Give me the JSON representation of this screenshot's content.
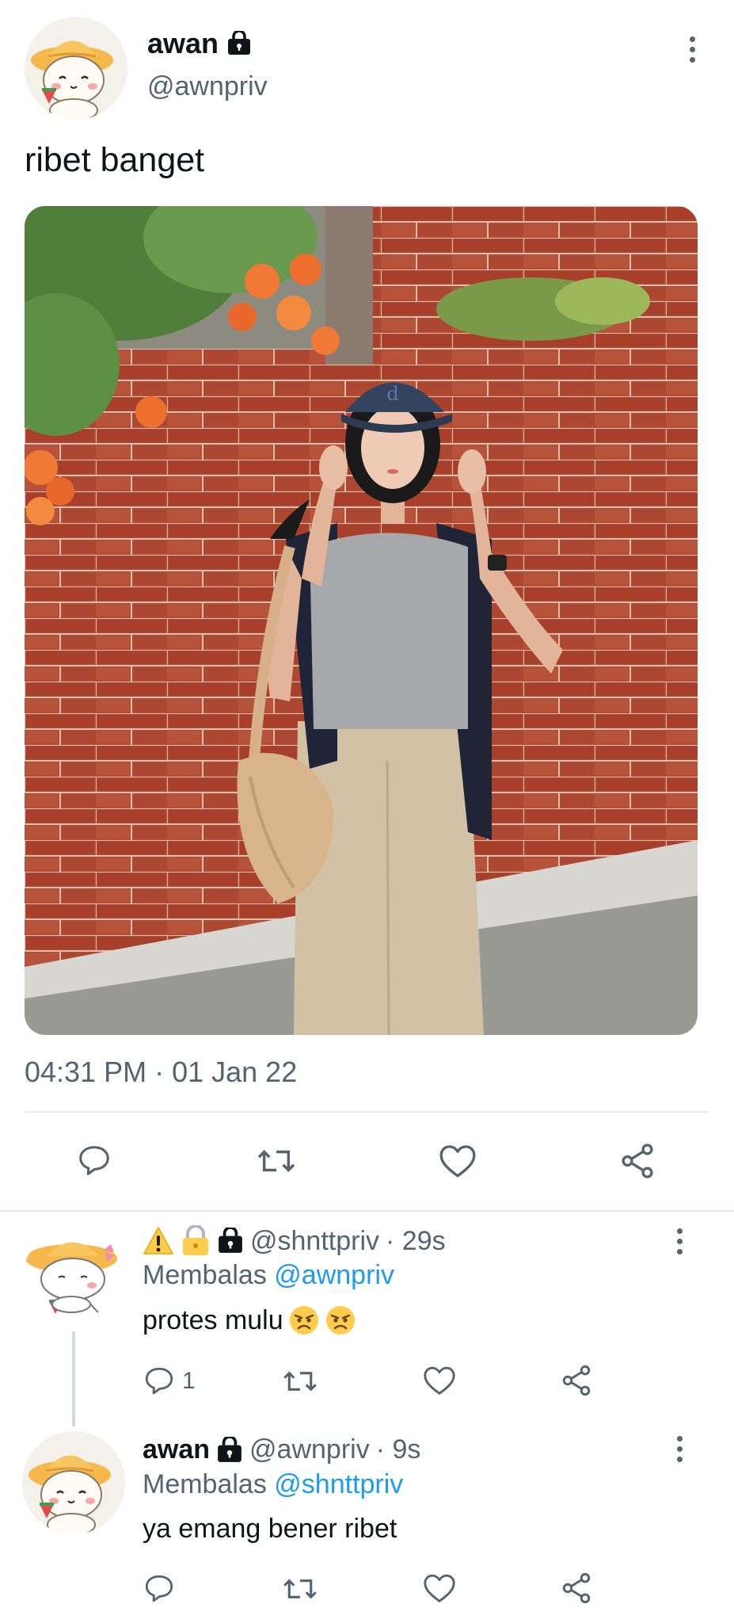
{
  "tweet": {
    "author_name": "awan",
    "author_handle": "@awnpriv",
    "text": "ribet banget",
    "timestamp": "04:31 PM · 01 Jan 22",
    "photo_alt": "woman in navy cap with grey tee and beige pants standing in front of a red brick wall with orange flowers",
    "icons": [
      "lock-icon",
      "more-icon",
      "reply-icon",
      "retweet-icon",
      "like-icon",
      "share-icon"
    ]
  },
  "replies": [
    {
      "author_name": "",
      "author_prefix_emojis": [
        "warning-emoji",
        "padlock-emoji"
      ],
      "author_handle": "@shnttpriv",
      "time": "· 29s",
      "replying_prefix": "Membalas",
      "replying_to": "@awnpriv",
      "text": "protes mulu",
      "text_emojis": [
        "angry-face-emoji",
        "angry-face-emoji"
      ],
      "reply_count": "1"
    },
    {
      "author_name": "awan",
      "author_handle": "@awnpriv",
      "time": "· 9s",
      "replying_prefix": "Membalas",
      "replying_to": "@shnttpriv",
      "text": "ya emang bener ribet",
      "reply_count": ""
    }
  ],
  "colors": {
    "text_primary": "#0f1419",
    "text_secondary": "#536471",
    "accent": "#1d9bf0",
    "divider": "#e6e9eb"
  }
}
